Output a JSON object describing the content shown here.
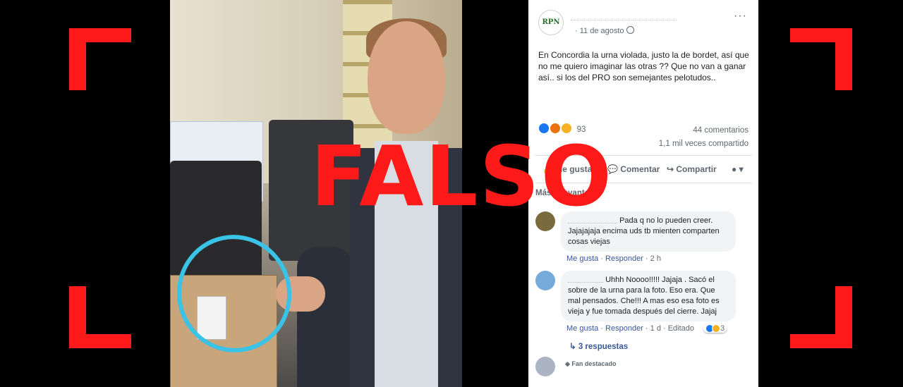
{
  "overlay": {
    "stamp": "FALSO"
  },
  "post": {
    "page_logo": "RPN",
    "date": "11 de agosto",
    "more_icon": "···",
    "text": "En Concordia la urna violada, justo la de bordet, así que no me quiero imaginar las otras ?? Que no van a ganar así.. si los del PRO son semejantes pelotudos..",
    "reactions_count": "93",
    "comments_count": "44 comentarios",
    "shares_count": "1,1 mil veces compartido",
    "actions": {
      "like": "Me gusta",
      "comment": "Comentar",
      "share": "Compartir"
    },
    "sort_label": "Más relevantes"
  },
  "comments": [
    {
      "text": "Pada q no lo pueden creer. Jajajajaja encima uds tb mienten comparten cosas viejas",
      "like": "Me gusta",
      "reply": "Responder",
      "time": "2 h"
    },
    {
      "text": "Uhhh Noooo!!!!! Jajaja . Sacó el sobre de la urna para la foto. Eso era. Que mal pensados. Che!!! A mas eso esa foto es vieja y fue tomada después del cierre. Jajaj",
      "like": "Me gusta",
      "reply": "Responder",
      "time": "1 d",
      "edited": "Editado",
      "reactions_count": "3"
    }
  ],
  "replies_label": "3 respuestas",
  "fan_badge": "Fan destacado",
  "colors": {
    "accent_red": "#ff1a1a",
    "link_blue": "#385898",
    "circle_cyan": "#39c3e6"
  }
}
